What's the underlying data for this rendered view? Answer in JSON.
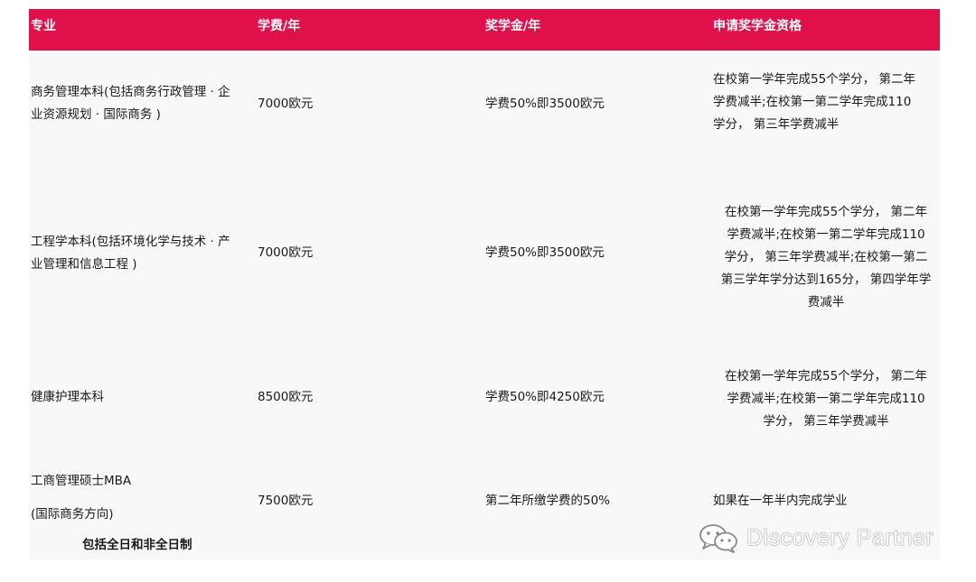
{
  "header": {
    "major": "专业",
    "tuition": "学费/年",
    "scholarship": "奖学金/年",
    "eligibility": "申请奖学金资格"
  },
  "rows": [
    {
      "major_lines": [
        "商务管理本科(包括商务行政管理 · 企",
        "业资源规划 · 国际商务 )"
      ],
      "tuition": "7000欧元",
      "scholarship": "学费50%即3500欧元",
      "eligibility_lines": [
        "在校第一学年完成55个学分， 第二年",
        "学费减半;在校第一第二学年完成110",
        "学分， 第三年学费减半"
      ]
    },
    {
      "major_lines": [
        "工程学本科(包括环境化学与技术 · 产",
        "业管理和信息工程 )"
      ],
      "tuition": "7000欧元",
      "scholarship": "学费50%即3500欧元",
      "eligibility_lines": [
        "在校第一学年完成55个学分， 第二年",
        "学费减半;在校第一第二学年完成110",
        "学分， 第三年学费减半;在校第一第二",
        "第三学年学分达到165分， 第四学年学",
        "费减半"
      ]
    },
    {
      "major_lines": [
        "健康护理本科"
      ],
      "tuition": "8500欧元",
      "scholarship": "学费50%即4250欧元",
      "eligibility_lines": [
        "在校第一学年完成55个学分， 第二年",
        "学费减半;在校第一第二学年完成110",
        "学分， 第三年学费减半"
      ]
    },
    {
      "major_lines": [
        "工商管理硕士MBA",
        "(国际商务方向)",
        "包括全日和非全日制"
      ],
      "tuition": "7500欧元",
      "scholarship": "第二年所缴学费的50%",
      "eligibility_lines": [
        "如果在一年半内完成学业"
      ]
    }
  ],
  "watermark": {
    "text": "Discovery Partner",
    "icon": "wechat-icon"
  },
  "colors": {
    "header_bg": "#e0104a",
    "header_text": "#ffffff",
    "table_bg": "#f8f8f8"
  }
}
